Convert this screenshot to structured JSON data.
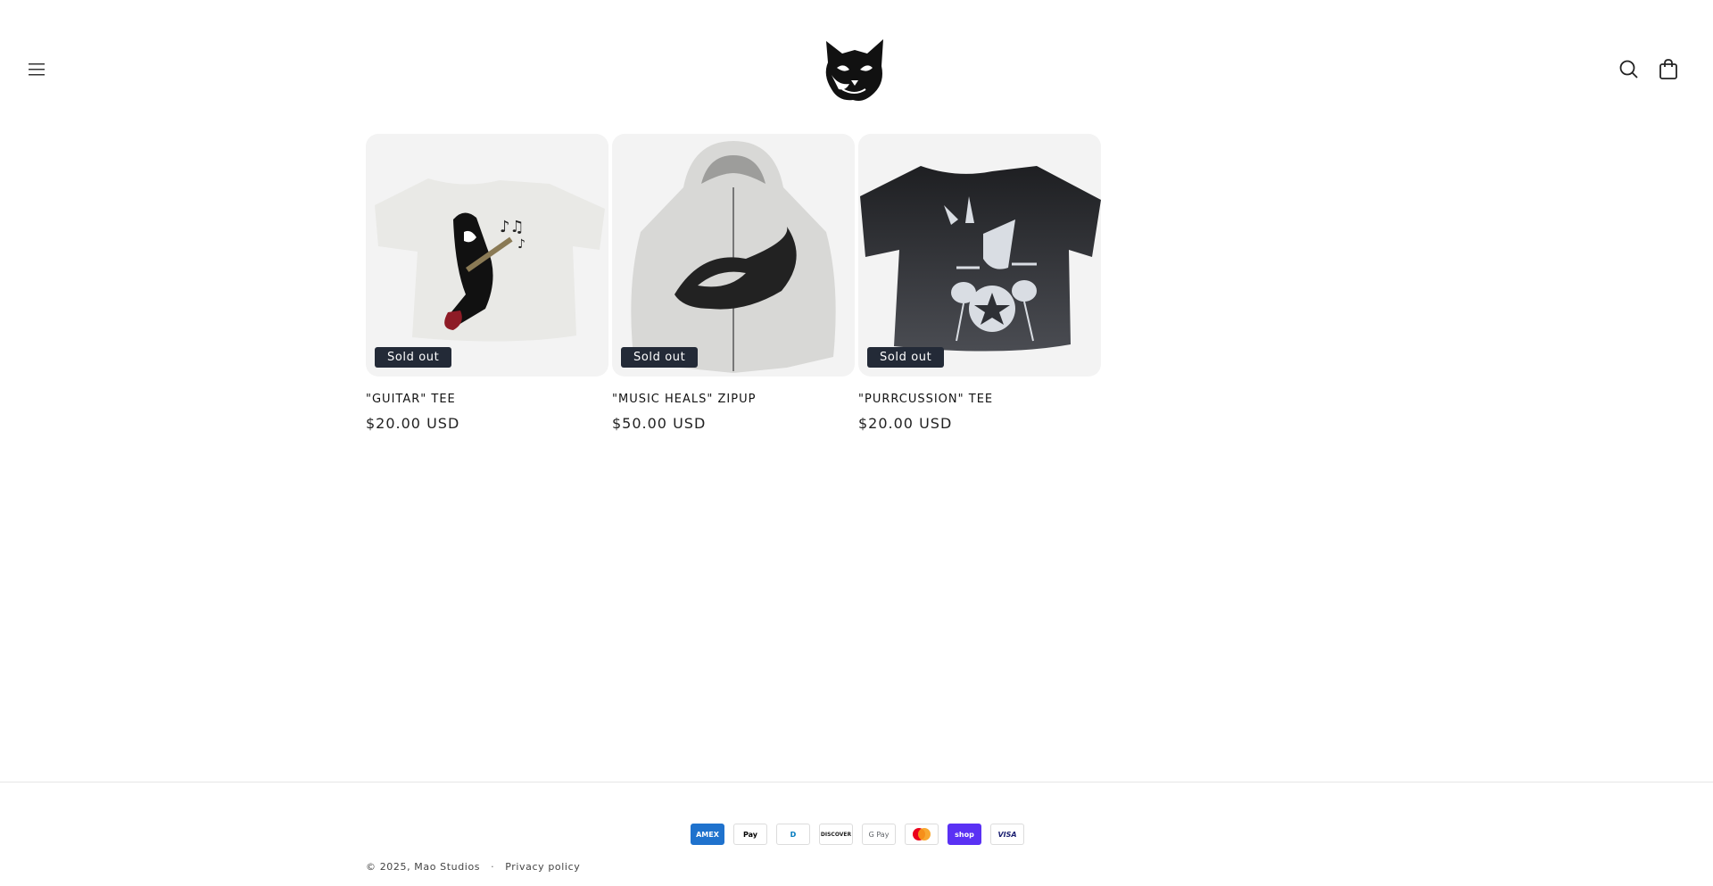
{
  "header": {
    "menu_icon": "hamburger-icon",
    "logo_icon": "cat-face-logo",
    "search_icon": "search-icon",
    "cart_icon": "cart-icon"
  },
  "products": [
    {
      "title": "\"GUITAR\" TEE",
      "price": "$20.00 USD",
      "badge": "Sold out"
    },
    {
      "title": "\"MUSIC HEALS\" ZIPUP",
      "price": "$50.00 USD",
      "badge": "Sold out"
    },
    {
      "title": "\"PURRCUSSION\" TEE",
      "price": "$20.00 USD",
      "badge": "Sold out"
    }
  ],
  "footer": {
    "payments": [
      {
        "name": "American Express",
        "label": "AMEX",
        "color": "#1f72cd"
      },
      {
        "name": "Apple Pay",
        "label": "Pay",
        "color": "#000000"
      },
      {
        "name": "Diners Club",
        "label": "D",
        "color": "#0079be"
      },
      {
        "name": "Discover",
        "label": "DISCOVER",
        "color": "#f38019"
      },
      {
        "name": "Google Pay",
        "label": "G Pay",
        "color": "#5f6368"
      },
      {
        "name": "Mastercard",
        "label": "",
        "color": "#eb001b"
      },
      {
        "name": "Shop Pay",
        "label": "shop",
        "color": "#5a31f4"
      },
      {
        "name": "Visa",
        "label": "VISA",
        "color": "#1a1f71"
      }
    ],
    "copyright": "© 2025, Mao Studios",
    "separator": "·",
    "privacy_link": "Privacy policy"
  }
}
